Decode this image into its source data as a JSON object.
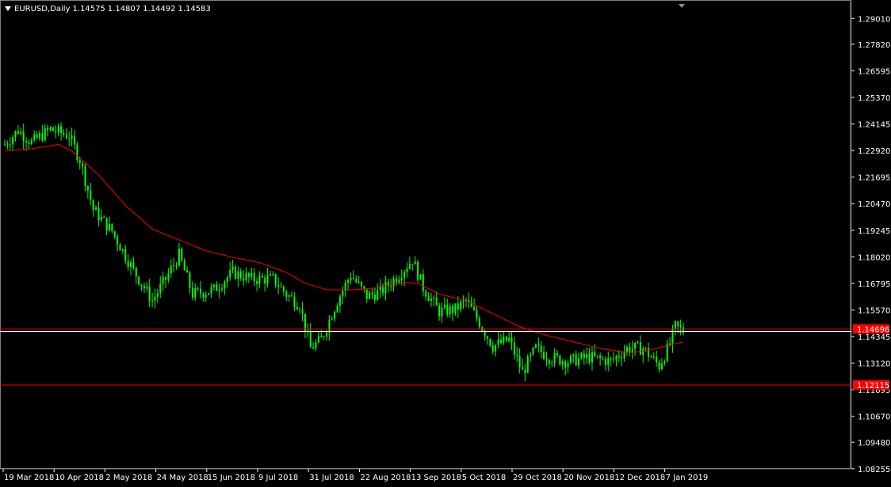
{
  "header": {
    "symbol": "EURUSD,Daily",
    "open": "1.14575",
    "high": "1.14807",
    "low": "1.14492",
    "close": "1.14583"
  },
  "colors": {
    "background": "#000000",
    "candle": "#00ff00",
    "ma_line": "#ff0000",
    "axis_text": "#ffffff",
    "frame": "#808080"
  },
  "icons": [
    "dropdown-triangle-icon",
    "chart-shift-marker-icon"
  ],
  "chart_data": {
    "type": "candlestick",
    "symbol": "EURUSD",
    "timeframe": "Daily",
    "y_axis": {
      "range": [
        1.0825,
        1.2975
      ],
      "ticks": [
        "1.29010",
        "1.27820",
        "1.26595",
        "1.25370",
        "1.24145",
        "1.22920",
        "1.21695",
        "1.20470",
        "1.19245",
        "1.18020",
        "1.16795",
        "1.15570",
        "1.14345",
        "1.13120",
        "1.11895",
        "1.10670",
        "1.09480",
        "1.08255"
      ]
    },
    "x_axis": {
      "labels": [
        "19 Mar 2018",
        "10 Apr 2018",
        "2 May 2018",
        "24 May 2018",
        "15 Jun 2018",
        "9 Jul 2018",
        "31 Jul 2018",
        "22 Aug 2018",
        "13 Sep 2018",
        "5 Oct 2018",
        "29 Oct 2018",
        "20 Nov 2018",
        "12 Dec 2018",
        "7 Jan 2019"
      ]
    },
    "close_series_anchor_points": [
      [
        0,
        1.232
      ],
      [
        5,
        1.2385
      ],
      [
        10,
        1.233
      ],
      [
        17,
        1.239
      ],
      [
        24,
        1.236
      ],
      [
        28,
        1.225
      ],
      [
        33,
        1.202
      ],
      [
        40,
        1.192
      ],
      [
        48,
        1.174
      ],
      [
        55,
        1.16
      ],
      [
        60,
        1.17
      ],
      [
        65,
        1.181
      ],
      [
        70,
        1.163
      ],
      [
        78,
        1.165
      ],
      [
        85,
        1.173
      ],
      [
        92,
        1.17
      ],
      [
        100,
        1.17
      ],
      [
        105,
        1.163
      ],
      [
        110,
        1.158
      ],
      [
        114,
        1.138
      ],
      [
        118,
        1.142
      ],
      [
        124,
        1.16
      ],
      [
        129,
        1.172
      ],
      [
        135,
        1.162
      ],
      [
        140,
        1.164
      ],
      [
        147,
        1.172
      ],
      [
        152,
        1.179
      ],
      [
        156,
        1.166
      ],
      [
        162,
        1.155
      ],
      [
        168,
        1.156
      ],
      [
        172,
        1.16
      ],
      [
        176,
        1.152
      ],
      [
        182,
        1.139
      ],
      [
        188,
        1.142
      ],
      [
        193,
        1.127
      ],
      [
        198,
        1.138
      ],
      [
        203,
        1.134
      ],
      [
        210,
        1.132
      ],
      [
        218,
        1.134
      ],
      [
        226,
        1.132
      ],
      [
        232,
        1.138
      ],
      [
        238,
        1.138
      ],
      [
        244,
        1.13
      ],
      [
        248,
        1.14
      ],
      [
        250,
        1.148
      ],
      [
        253,
        1.146
      ]
    ],
    "moving_average_anchor_points": [
      [
        0,
        1.229
      ],
      [
        10,
        1.23
      ],
      [
        20,
        1.232
      ],
      [
        25,
        1.229
      ],
      [
        35,
        1.218
      ],
      [
        45,
        1.204
      ],
      [
        55,
        1.193
      ],
      [
        65,
        1.188
      ],
      [
        75,
        1.183
      ],
      [
        85,
        1.18
      ],
      [
        95,
        1.1775
      ],
      [
        105,
        1.173
      ],
      [
        112,
        1.168
      ],
      [
        120,
        1.165
      ],
      [
        130,
        1.165
      ],
      [
        140,
        1.166
      ],
      [
        148,
        1.1685
      ],
      [
        154,
        1.168
      ],
      [
        162,
        1.163
      ],
      [
        172,
        1.16
      ],
      [
        182,
        1.154
      ],
      [
        192,
        1.148
      ],
      [
        202,
        1.144
      ],
      [
        212,
        1.141
      ],
      [
        222,
        1.138
      ],
      [
        232,
        1.136
      ],
      [
        240,
        1.137
      ],
      [
        246,
        1.139
      ],
      [
        253,
        1.141
      ]
    ],
    "bar_count": 254,
    "horizontal_lines": [
      {
        "price": 1.14696,
        "label": "1.14696",
        "color": "#ff0000"
      },
      {
        "price": 1.14583,
        "label": "",
        "color": "#ffffff"
      },
      {
        "price": 1.12115,
        "label": "1.12115",
        "color": "#ff0000"
      }
    ]
  }
}
